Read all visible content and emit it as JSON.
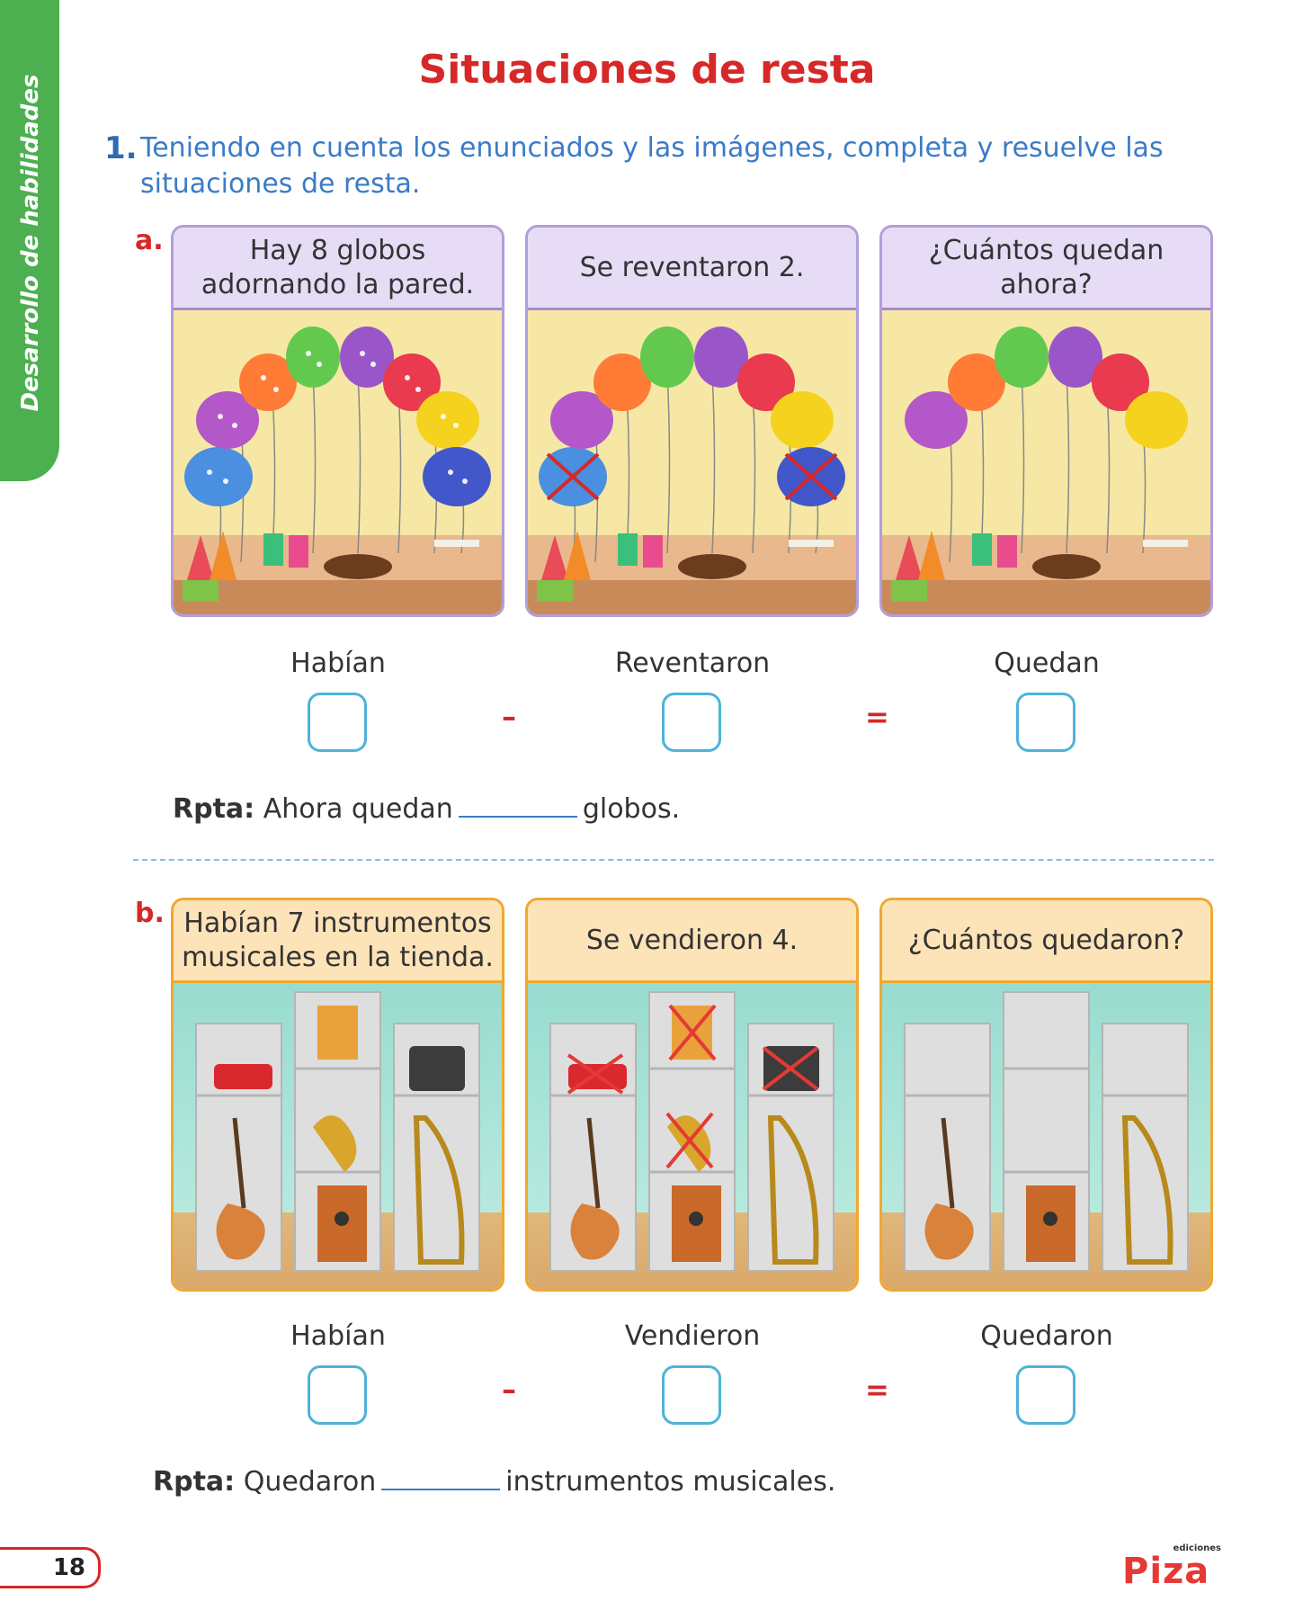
{
  "side_tab": "Desarrollo de habilidades",
  "title": "Situaciones de resta",
  "question": {
    "number": "1.",
    "text": "Teniendo en cuenta los enunciados y las imágenes, completa y resuelve las situaciones de resta."
  },
  "part_a": {
    "letter": "a.",
    "panels": [
      "Hay 8 globos adornando la pared.",
      "Se reventaron 2.",
      "¿Cuántos quedan ahora?"
    ],
    "labels": [
      "Habían",
      "Reventaron",
      "Quedan"
    ],
    "minus": "–",
    "equals": "=",
    "rpta_label": "Rpta:",
    "rpta_before": "Ahora quedan",
    "rpta_after": "globos."
  },
  "part_b": {
    "letter": "b.",
    "panels": [
      "Habían 7 instrumentos musicales en la tienda.",
      "Se vendieron 4.",
      "¿Cuántos quedaron?"
    ],
    "labels": [
      "Habían",
      "Vendieron",
      "Quedaron"
    ],
    "minus": "–",
    "equals": "=",
    "rpta_label": "Rpta:",
    "rpta_before": "Quedaron",
    "rpta_after": "instrumentos musicales."
  },
  "footer": {
    "page_number": "18",
    "logo_small": "ediciones",
    "logo": "Piza"
  },
  "colors": {
    "title_red": "#d62828",
    "side_green": "#4caf50",
    "question_blue": "#3a7bc8",
    "panel_purple": "#e7dcf5",
    "panel_orange": "#fde3b8",
    "box_blue": "#4fb3d9"
  }
}
